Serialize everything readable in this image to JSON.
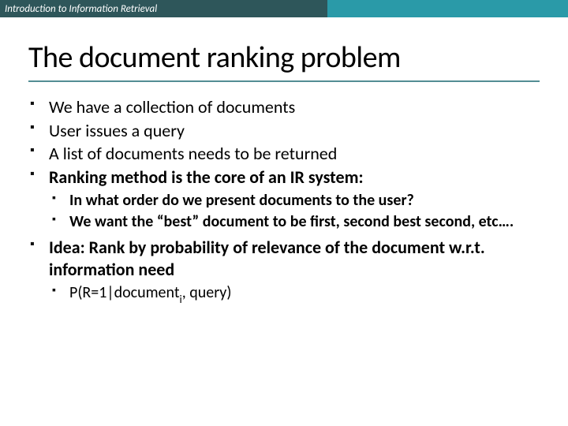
{
  "header": "Introduction to Information Retrieval",
  "title": "The document ranking problem",
  "bullets": [
    {
      "text": "We have a collection of documents"
    },
    {
      "text": "User issues a query"
    },
    {
      "text": "A list of documents needs to be returned"
    },
    {
      "text": "Ranking method is the core of an IR system:",
      "sub": [
        "In what order do we present documents to the user?",
        "We want the “best” document to be first, second best second, etc…."
      ]
    },
    {
      "text": "Idea: Rank by probability of relevance of the document w.r.t. information need",
      "sub_prefix": "P(R=1|document",
      "sub_subscript": "i",
      "sub_suffix": ", query)"
    }
  ]
}
